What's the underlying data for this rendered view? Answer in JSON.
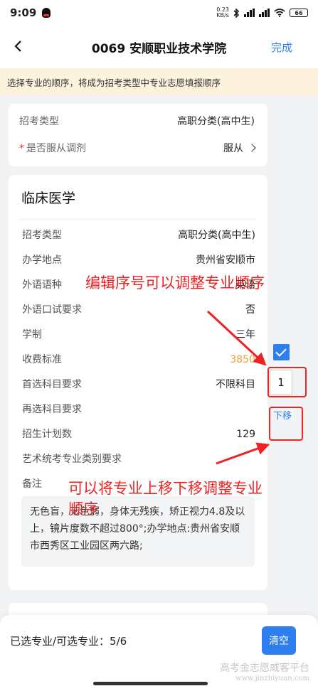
{
  "status": {
    "time": "9:09",
    "net_speed_value": "0.23",
    "net_speed_unit": "KB/s",
    "battery": "66"
  },
  "nav": {
    "title": "0069 安顺职业技术学院",
    "done": "完成"
  },
  "tip": "选择专业的顺序，将成为招考类型中专业志愿填报顺序",
  "top_card": {
    "exam_type_label": "招考类型",
    "exam_type_value": "高职分类(高中生)",
    "adjust_label": "是否服从调剂",
    "adjust_value": "服从"
  },
  "major": {
    "name": "临床医学",
    "rows": [
      {
        "label": "招考类型",
        "value": "高职分类(高中生)"
      },
      {
        "label": "办学地点",
        "value": "贵州省安顺市"
      },
      {
        "label": "外语语种",
        "value": "英语"
      },
      {
        "label": "外语口试要求",
        "value": "否"
      },
      {
        "label": "学制",
        "value": "三年"
      },
      {
        "label": "收费标准",
        "value": "3850"
      },
      {
        "label": "首选科目要求",
        "value": "不限科目"
      },
      {
        "label": "再选科目要求",
        "value": ""
      },
      {
        "label": "招生计划数",
        "value": "129"
      },
      {
        "label": "艺术统考专业类别要求",
        "value": ""
      },
      {
        "label": "备注",
        "value": ""
      }
    ],
    "note": "无色盲，无色弱，身体无残疾，矫正视力4.8及以上，镜片度数不超过800°;办学地点:贵州省安顺市西秀区工业园区两六路;",
    "order_value": "1",
    "move_down": "下移"
  },
  "annotations": {
    "edit_order": "编辑序号可以调整专业顺序",
    "move_line1": "可以将专业上移下移调整专业",
    "move_line2": "顺序"
  },
  "bottom": {
    "count_text": "已选专业/可选专业：5/6",
    "clear": "清空"
  },
  "watermark": {
    "line1": "高考金志愿威客平台",
    "line2": "www.jinzhiyuan.com"
  },
  "colors": {
    "accent": "#2d7ff0",
    "annotation": "#ee2222",
    "fee": "#f0a03a",
    "tip_bg": "#fdf2de"
  }
}
